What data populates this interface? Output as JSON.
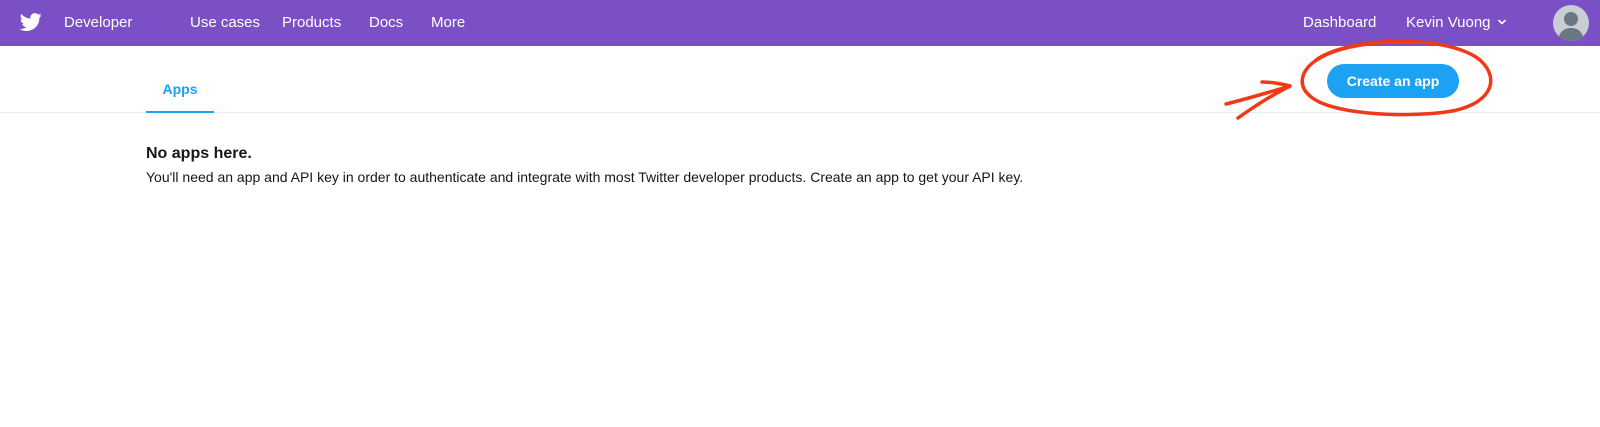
{
  "header": {
    "brand": "Developer",
    "logo_icon": "twitter-bird-icon",
    "nav": [
      "Use cases",
      "Products",
      "Docs",
      "More"
    ],
    "dashboard": "Dashboard",
    "user_name": "Kevin Vuong",
    "chevron_icon": "chevron-down-icon",
    "avatar_icon": "default-avatar-icon",
    "background_color": "#7b4fc6"
  },
  "tabs": {
    "apps": "Apps",
    "active_color": "#1da1f2"
  },
  "actions": {
    "create_app": "Create an app",
    "button_color": "#1da1f2"
  },
  "annotation": {
    "color": "#f03a17",
    "shapes": [
      "circle-highlight",
      "arrow-pointer"
    ]
  },
  "empty_state": {
    "title": "No apps here.",
    "description": "You'll need an app and API key in order to authenticate and integrate with most Twitter developer products. Create an app to get your API key."
  }
}
